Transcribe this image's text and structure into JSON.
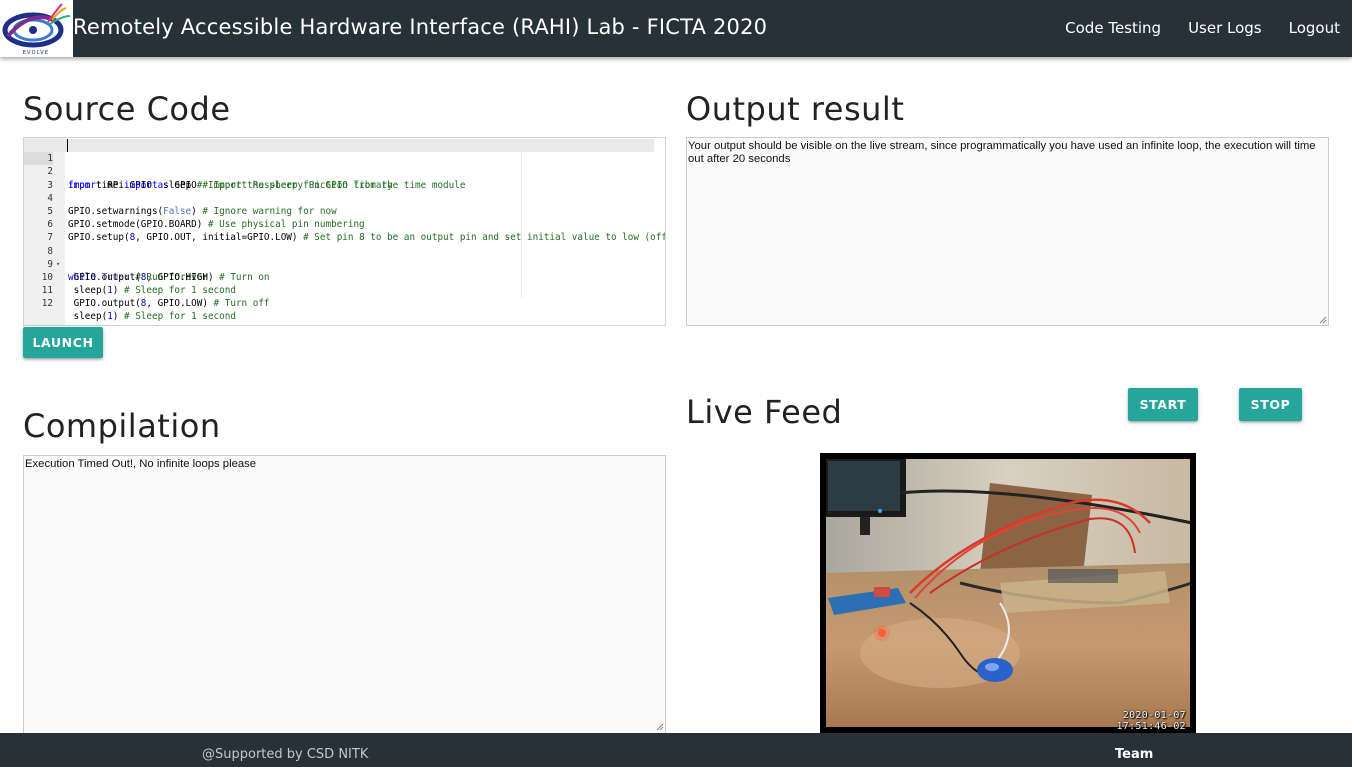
{
  "header": {
    "logo_text": "EVOLVE",
    "brand": "Remotely Accessible Hardware Interface (RAHI) Lab - FICTA 2020",
    "nav": [
      {
        "label": "Code Testing"
      },
      {
        "label": "User Logs"
      },
      {
        "label": "Logout"
      }
    ]
  },
  "source": {
    "title": "Source Code",
    "code_lines": [
      {
        "n": "1",
        "text": "import RPi.GPIO as GPIO # Import Raspberry Pi GPIO library"
      },
      {
        "n": "2",
        "text": "from time import sleep # Import the sleep function from the time module"
      },
      {
        "n": "3",
        "text": ""
      },
      {
        "n": "4",
        "text": "GPIO.setwarnings(False) # Ignore warning for now"
      },
      {
        "n": "5",
        "text": "GPIO.setmode(GPIO.BOARD) # Use physical pin numbering"
      },
      {
        "n": "6",
        "text": "GPIO.setup(8, GPIO.OUT, initial=GPIO.LOW) # Set pin 8 to be an output pin and set initial value to low (off)"
      },
      {
        "n": "7",
        "text": ""
      },
      {
        "n": "8",
        "text": "while True: # Run forever"
      },
      {
        "n": "9",
        "text": " GPIO.output(8, GPIO.HIGH) # Turn on"
      },
      {
        "n": "10",
        "text": " sleep(1) # Sleep for 1 second"
      },
      {
        "n": "11",
        "text": " GPIO.output(8, GPIO.LOW) # Turn off"
      },
      {
        "n": "12",
        "text": " sleep(1) # Sleep for 1 second"
      }
    ],
    "launch_label": "LAUNCH"
  },
  "output": {
    "title": "Output result",
    "text": "Your output should be visible on the live stream, since programmatically you have used an infinite loop, the execution will time out after 20 seconds"
  },
  "compilation": {
    "title": "Compilation",
    "text": "Execution Timed Out!, No infinite loops please"
  },
  "live_feed": {
    "title": "Live Feed",
    "start_label": "START",
    "stop_label": "STOP",
    "timestamp_date": "2020-01-07",
    "timestamp_time": "17:51:46-02"
  },
  "footer": {
    "supported": "@Supported by CSD NITK",
    "team": "Team"
  },
  "colors": {
    "nav_bg": "#263238",
    "accent": "#26a69a",
    "code_keyword": "#0000ff",
    "code_comment": "#236e24"
  }
}
